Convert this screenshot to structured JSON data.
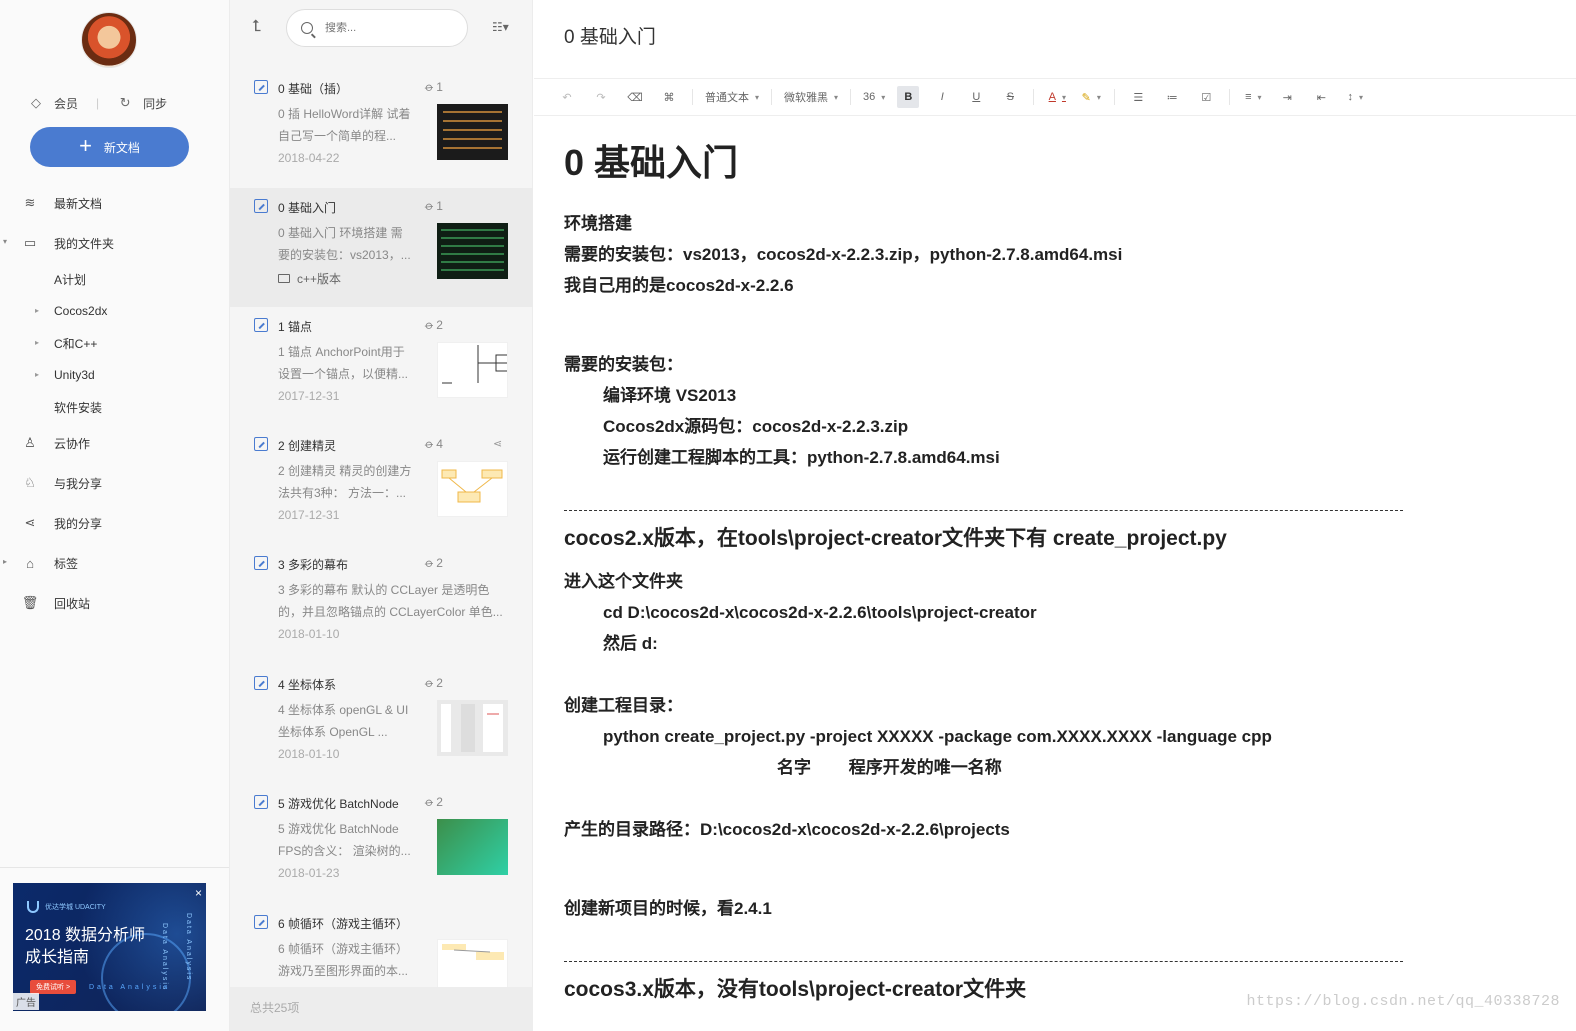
{
  "sidebar": {
    "quick": {
      "vip_label": "会员",
      "sync_label": "同步"
    },
    "new_doc_label": "新文档",
    "nav": {
      "recent": "最新文档",
      "my_folder": "我的文件夹",
      "sub_a": "A计划",
      "sub_cocos": "Cocos2dx",
      "sub_cpp": "C和C++",
      "sub_unity": "Unity3d",
      "sub_soft": "软件安装",
      "collab": "云协作",
      "shared_with_me": "与我分享",
      "my_shares": "我的分享",
      "tags": "标签",
      "trash": "回收站"
    },
    "ad": {
      "brand": "优达学城 UDACITY",
      "title_line1": "2018 数据分析师",
      "title_line2": "成长指南",
      "try_label": "免费试听 >",
      "ad_tag": "广告",
      "close": "×",
      "vertical_text": "Data Analysis"
    }
  },
  "doclist": {
    "search_placeholder": "搜索...",
    "footer": "总共25项",
    "docs": [
      {
        "title": "0 基础（插）",
        "attachments": "1",
        "snippet": "0 插 HelloWord详解 试着自己写一个简单的程...",
        "date": "2018-04-22"
      },
      {
        "title": "0 基础入门",
        "attachments": "1",
        "snippet": "0 基础入门 环境搭建 需要的安装包：vs2013，...",
        "folder": "c++版本"
      },
      {
        "title": "1 锚点",
        "attachments": "2",
        "snippet": "1 锚点 AnchorPoint用于设置一个锚点，以便精...",
        "date": "2017-12-31"
      },
      {
        "title": "2 创建精灵",
        "attachments": "4",
        "snippet": "2 创建精灵 精灵的创建方法共有3种： 方法一：...",
        "date": "2017-12-31"
      },
      {
        "title": "3 多彩的幕布",
        "attachments": "2",
        "snippet": "3 多彩的幕布 默认的 CCLayer 是透明色的，并且忽略锚点的 CCLayerColor 单色...",
        "date": "2018-01-10"
      },
      {
        "title": "4 坐标体系",
        "attachments": "2",
        "snippet": "4 坐标体系 openGL & UI 坐标体系 OpenGL ...",
        "date": "2018-01-10"
      },
      {
        "title": "5 游戏优化 BatchNode",
        "attachments": "2",
        "snippet": "5 游戏优化 BatchNode FPS的含义： 渲染树的...",
        "date": "2018-01-23"
      },
      {
        "title": "6 帧循环（游戏主循环）",
        "attachments": "",
        "snippet": "6 帧循环（游戏主循环）游戏乃至图形界面的本...",
        "date": ""
      }
    ]
  },
  "editor": {
    "title": "0 基础入门",
    "toolbar": {
      "para_style": "普通文本",
      "font_family": "微软雅黑",
      "font_size": "36"
    },
    "content": {
      "h1": "0 基础入门",
      "l1": "环境搭建",
      "l2": "需要的安装包：vs2013，cocos2d-x-2.2.3.zip，python-2.7.8.amd64.msi",
      "l3": "我自己用的是cocos2d-x-2.2.6",
      "l4": "需要的安装包：",
      "l5": "编译环境 VS2013",
      "l6": "Cocos2dx源码包：cocos2d-x-2.2.3.zip",
      "l7": "运行创建工程脚本的工具：python-2.7.8.amd64.msi",
      "h2a": "cocos2.x版本，在tools\\project-creator文件夹下有 create_project.py",
      "l8": "进入这个文件夹",
      "l9": "cd D:\\cocos2d-x\\cocos2d-x-2.2.6\\tools\\project-creator",
      "l10": "然后 d:",
      "l11": "创建工程目录：",
      "l12": "python create_project.py -project XXXXX -package com.XXXX.XXXX -language cpp",
      "l13": "名字        程序开发的唯一名称",
      "l14": "产生的目录路径：D:\\cocos2d-x\\cocos2d-x-2.2.6\\projects",
      "l15": "创建新项目的时候，看2.4.1",
      "h2b": "cocos3.x版本，没有tools\\project-creator文件夹"
    },
    "watermark": "https://blog.csdn.net/qq_40338728"
  }
}
